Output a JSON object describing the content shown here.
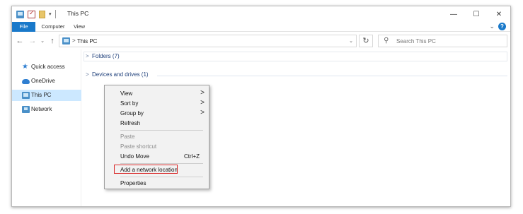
{
  "window": {
    "title": "This PC",
    "minimize_glyph": "—",
    "maximize_glyph": "☐",
    "close_glyph": "✕",
    "qat_dropdown_glyph": "▾"
  },
  "ribbon": {
    "tabs": [
      {
        "label": "File"
      },
      {
        "label": "Computer"
      },
      {
        "label": "View"
      }
    ],
    "expand_glyph": "⌄",
    "help_label": "?"
  },
  "address_bar": {
    "back_glyph": "←",
    "forward_glyph": "→",
    "recent_glyph": "⌄",
    "up_glyph": "↑",
    "separator_glyph": ">",
    "path": "This PC",
    "dropdown_glyph": "⌄",
    "refresh_glyph": "↻",
    "search_icon_glyph": "⚲",
    "search_placeholder": "Search This PC"
  },
  "sidebar": {
    "items": [
      {
        "label": "Quick access",
        "icon": "star-icon"
      },
      {
        "label": "OneDrive",
        "icon": "cloud-icon"
      },
      {
        "label": "This PC",
        "icon": "computer-icon",
        "selected": true
      },
      {
        "label": "Network",
        "icon": "network-icon"
      }
    ]
  },
  "content": {
    "groups": [
      {
        "label": "Folders (7)",
        "chevron": ">"
      },
      {
        "label": "Devices and drives (1)",
        "chevron": ">"
      }
    ]
  },
  "context_menu": {
    "items": [
      {
        "label": "View",
        "submenu": true
      },
      {
        "label": "Sort by",
        "submenu": true
      },
      {
        "label": "Group by",
        "submenu": true
      },
      {
        "label": "Refresh"
      },
      {
        "label": "Paste",
        "disabled": true
      },
      {
        "label": "Paste shortcut",
        "disabled": true
      },
      {
        "label": "Undo Move",
        "shortcut": "Ctrl+Z"
      },
      {
        "label": "Add a network location",
        "highlighted": true
      },
      {
        "label": "Properties"
      }
    ],
    "submenu_glyph": ">"
  },
  "colors": {
    "accent": "#1979ca",
    "selection": "#cce8ff",
    "highlight_border": "#d92b2b",
    "group_header_text": "#1e3f7a"
  }
}
